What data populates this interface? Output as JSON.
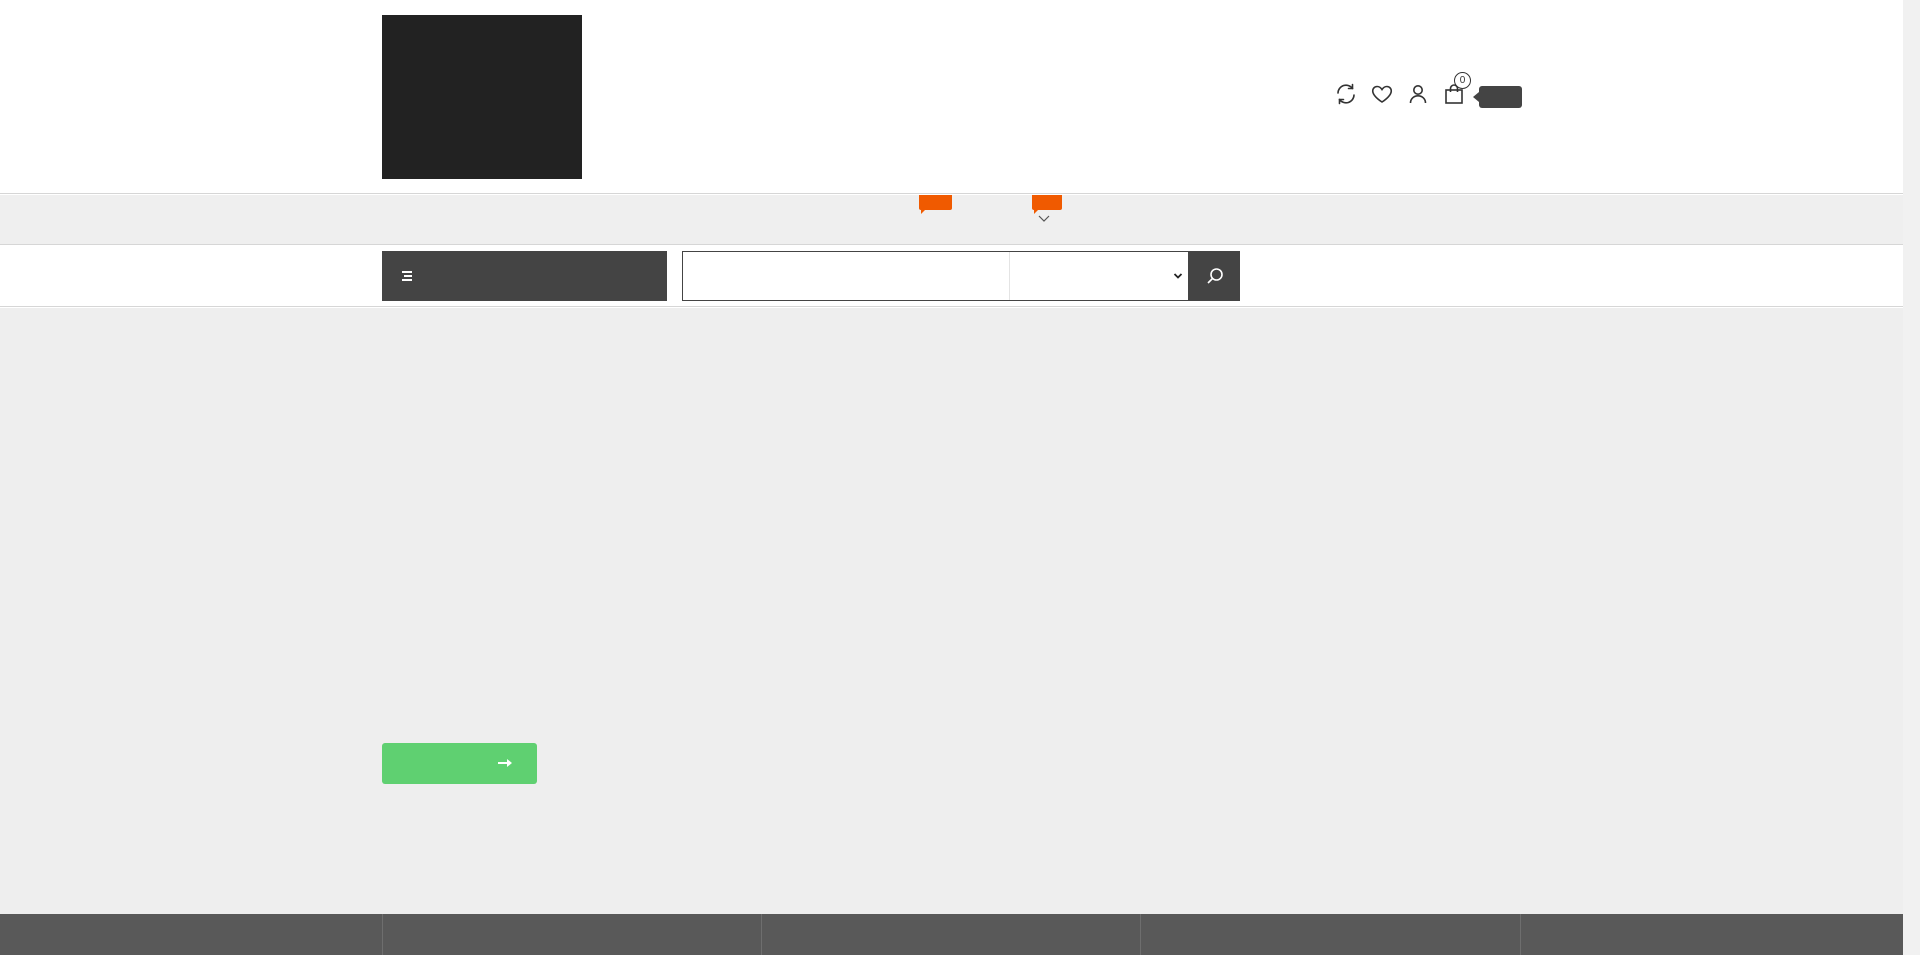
{
  "header": {
    "logo": "store-logo",
    "icons": [
      "refresh-icon",
      "heart-icon",
      "user-icon",
      "shopping-bag-icon"
    ],
    "cart_count": "0"
  },
  "nav": {
    "badges": [
      "menu-badge",
      "menu-badge"
    ],
    "dropdown_icon": "chevron-down-icon"
  },
  "search": {
    "category_button_icon": "menu-lines-icon",
    "input_value": "",
    "category_value": "",
    "button_icon": "search-icon"
  },
  "hero": {
    "cta_icon": "arrow-right-icon"
  },
  "colors": {
    "dark": "#444444",
    "accent_orange": "#f05a00",
    "cta_green": "#5fd071",
    "hero_bg": "#eeeeee",
    "footer_bg": "#595959"
  }
}
